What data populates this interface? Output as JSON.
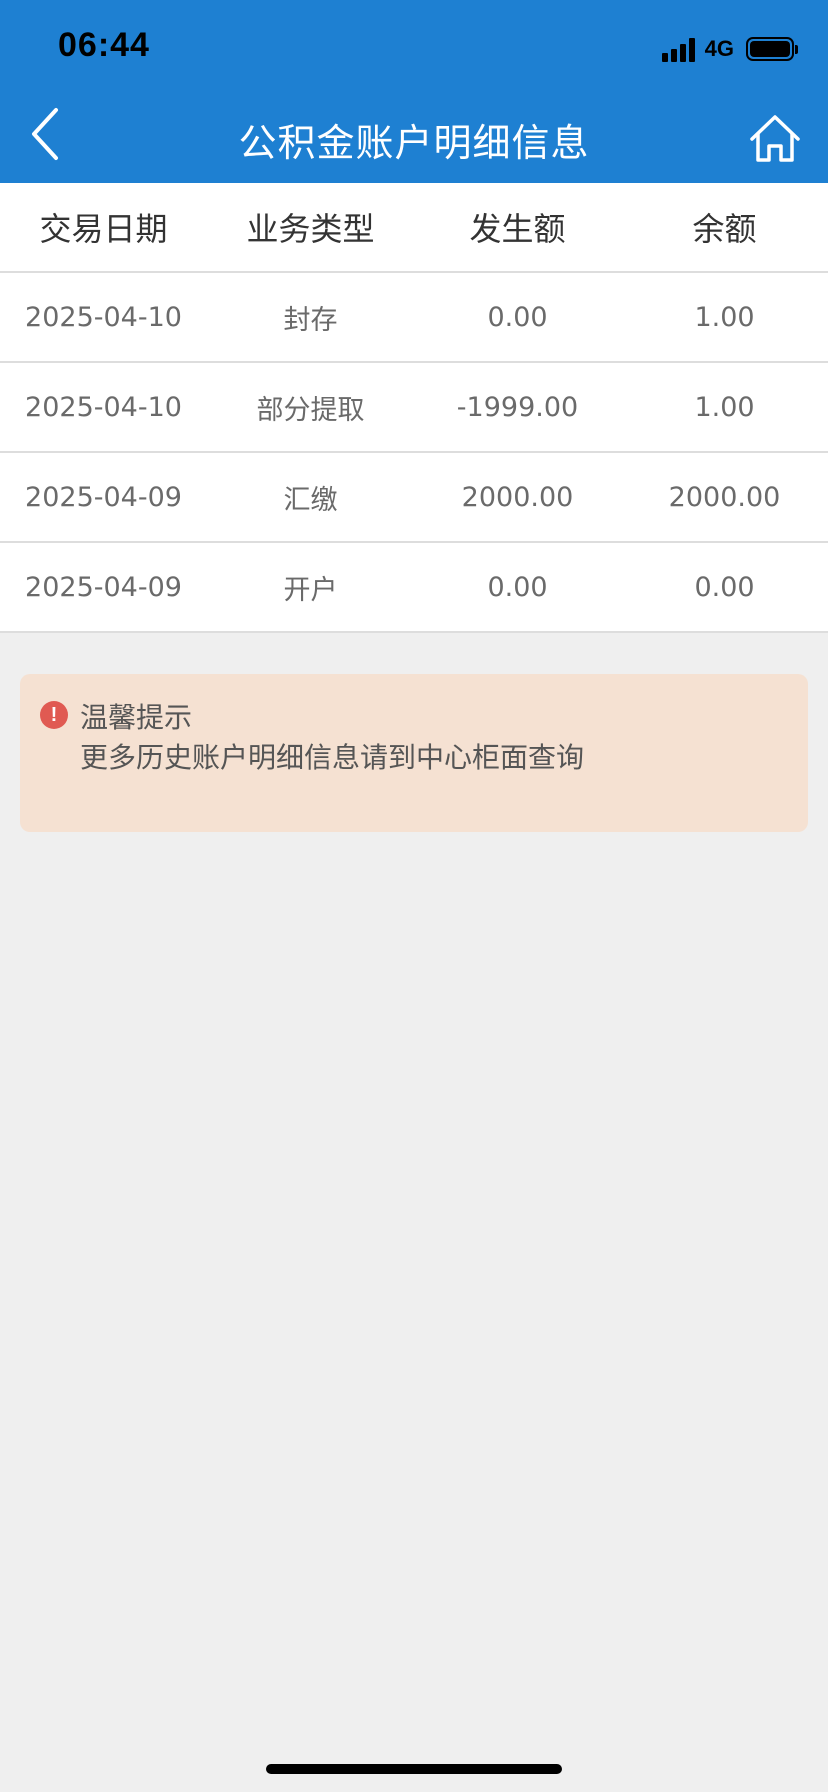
{
  "status_bar": {
    "time": "06:44",
    "network": "4G"
  },
  "nav": {
    "title": "公积金账户明细信息",
    "back_icon": "chevron-left-icon",
    "home_icon": "home-icon"
  },
  "table": {
    "columns": [
      "交易日期",
      "业务类型",
      "发生额",
      "余额"
    ],
    "rows": [
      [
        "2025-04-10",
        "封存",
        "0.00",
        "1.00"
      ],
      [
        "2025-04-10",
        "部分提取",
        "-1999.00",
        "1.00"
      ],
      [
        "2025-04-09",
        "汇缴",
        "2000.00",
        "2000.00"
      ],
      [
        "2025-04-09",
        "开户",
        "0.00",
        "0.00"
      ]
    ]
  },
  "notice": {
    "icon": "exclamation-icon",
    "title": "温馨提示",
    "text": "更多历史账户明细信息请到中心柜面查询"
  },
  "colors": {
    "primary": "#1e80d2",
    "notice_bg": "#f5e1d2",
    "alert": "#e05a52"
  }
}
